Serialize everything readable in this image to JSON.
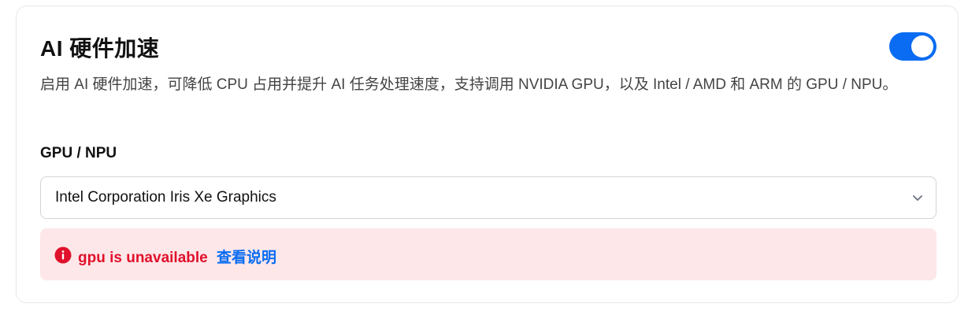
{
  "section": {
    "title": "AI 硬件加速",
    "toggle_on": true,
    "description": "启用 AI 硬件加速，可降低 CPU 占用并提升 AI 任务处理速度，支持调用 NVIDIA GPU，以及 Intel / AMD 和 ARM 的 GPU / NPU。"
  },
  "gpu_field": {
    "label": "GPU / NPU",
    "selected_value": "Intel Corporation Iris Xe Graphics"
  },
  "alert": {
    "message": "gpu is unavailable",
    "link_label": "查看说明"
  },
  "colors": {
    "accent": "#0a6cf2",
    "error": "#e0112b",
    "error_bg": "#fde7e9"
  },
  "icons": {
    "toggle": "toggle-switch",
    "select": "chevron-down-icon",
    "alert": "error-info-icon"
  }
}
